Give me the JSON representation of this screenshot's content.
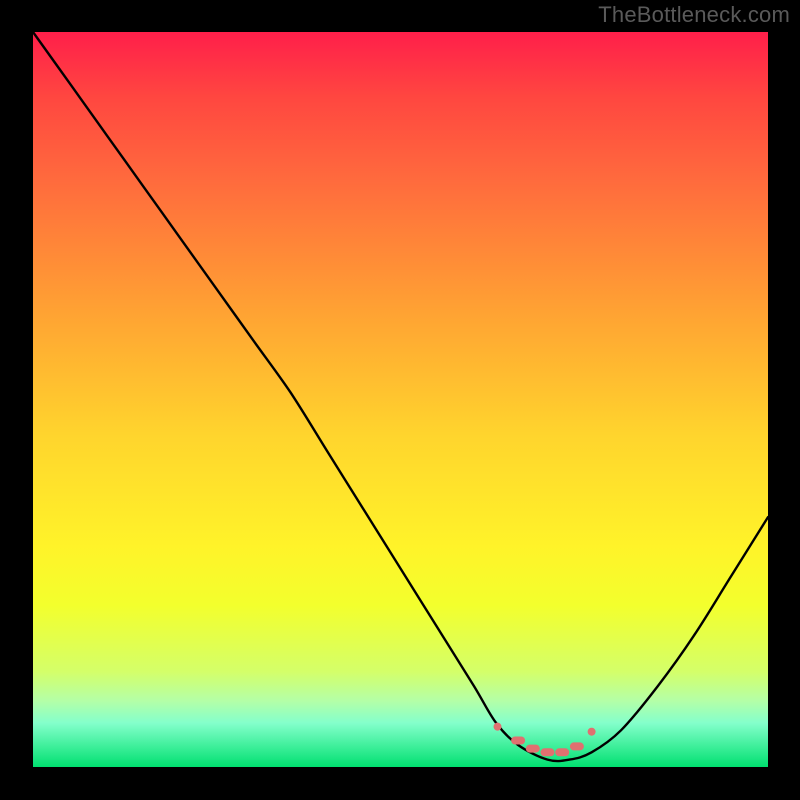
{
  "watermark": "TheBottleneck.com",
  "chart_data": {
    "type": "line",
    "title": "",
    "xlabel": "",
    "ylabel": "",
    "xlim": [
      0,
      100
    ],
    "ylim": [
      0,
      100
    ],
    "series": [
      {
        "name": "bottleneck-curve",
        "x": [
          0,
          5,
          10,
          15,
          20,
          25,
          30,
          35,
          40,
          45,
          50,
          55,
          60,
          63,
          66,
          70,
          73,
          76,
          80,
          85,
          90,
          95,
          100
        ],
        "values": [
          100,
          93,
          86,
          79,
          72,
          65,
          58,
          51,
          43,
          35,
          27,
          19,
          11,
          6,
          3,
          1,
          1,
          2,
          5,
          11,
          18,
          26,
          34
        ]
      }
    ],
    "markers": {
      "name": "optimal-range",
      "color": "#e07070",
      "points_x": [
        63.2,
        66,
        68,
        70,
        72,
        74,
        76
      ],
      "points_y": [
        5.5,
        3.6,
        2.5,
        2.0,
        2.0,
        2.8,
        4.8
      ]
    },
    "gradient_stops": [
      {
        "pos": 0.0,
        "color": "#ff1f4a"
      },
      {
        "pos": 0.09,
        "color": "#ff4740"
      },
      {
        "pos": 0.2,
        "color": "#ff6a3d"
      },
      {
        "pos": 0.38,
        "color": "#ffa233"
      },
      {
        "pos": 0.55,
        "color": "#ffd52d"
      },
      {
        "pos": 0.7,
        "color": "#fff329"
      },
      {
        "pos": 0.78,
        "color": "#f3ff2d"
      },
      {
        "pos": 0.87,
        "color": "#d4ff69"
      },
      {
        "pos": 0.91,
        "color": "#b4ffa7"
      },
      {
        "pos": 0.94,
        "color": "#84ffcb"
      },
      {
        "pos": 1.0,
        "color": "#00e070"
      }
    ]
  }
}
